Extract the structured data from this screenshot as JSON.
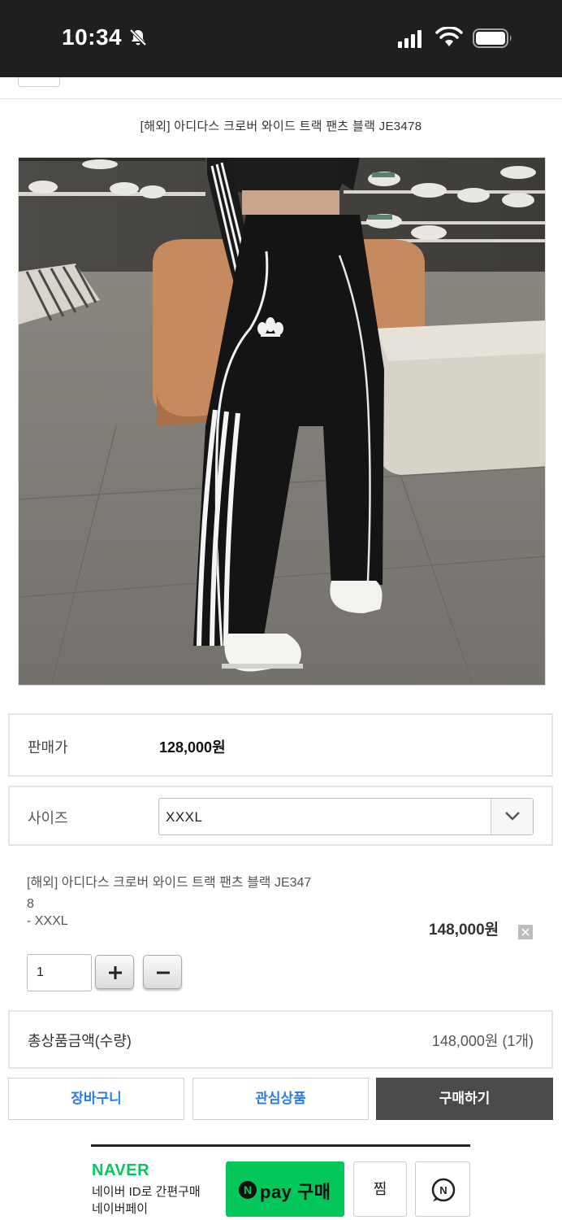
{
  "status_bar": {
    "time": "10:34"
  },
  "product": {
    "title": "[해외] 아디다스 크로버 와이드 트랙 팬츠 블랙 JE3478",
    "image_alt": "adidas"
  },
  "price": {
    "label": "판매가",
    "value": "128,000원"
  },
  "size": {
    "label": "사이즈",
    "selected": "XXXL"
  },
  "selected_item": {
    "name_line1": "[해외] 아디다스 크로버 와이드 트랙 팬츠 블랙 JE347",
    "name_line2": "8",
    "option": "- XXXL",
    "price": "148,000원",
    "quantity": "1",
    "plus": "+",
    "minus": "−"
  },
  "total": {
    "label": "총상품금액(수량)",
    "value": "148,000원 (1개)"
  },
  "actions": {
    "cart": "장바구니",
    "wishlist": "관심상품",
    "buy": "구매하기"
  },
  "naver_pay": {
    "brand": "NAVER",
    "desc_line1": "네이버 ID로 간편구매",
    "desc_line2": "네이버페이",
    "pay_n": "N",
    "pay_label": "pay 구매",
    "zzim": "찜"
  },
  "colors": {
    "status_bar_bg": "#1f1f1f",
    "link_blue": "#2a7be4",
    "buy_button_bg": "#4a4a4a",
    "naver_green": "#03c75a"
  }
}
